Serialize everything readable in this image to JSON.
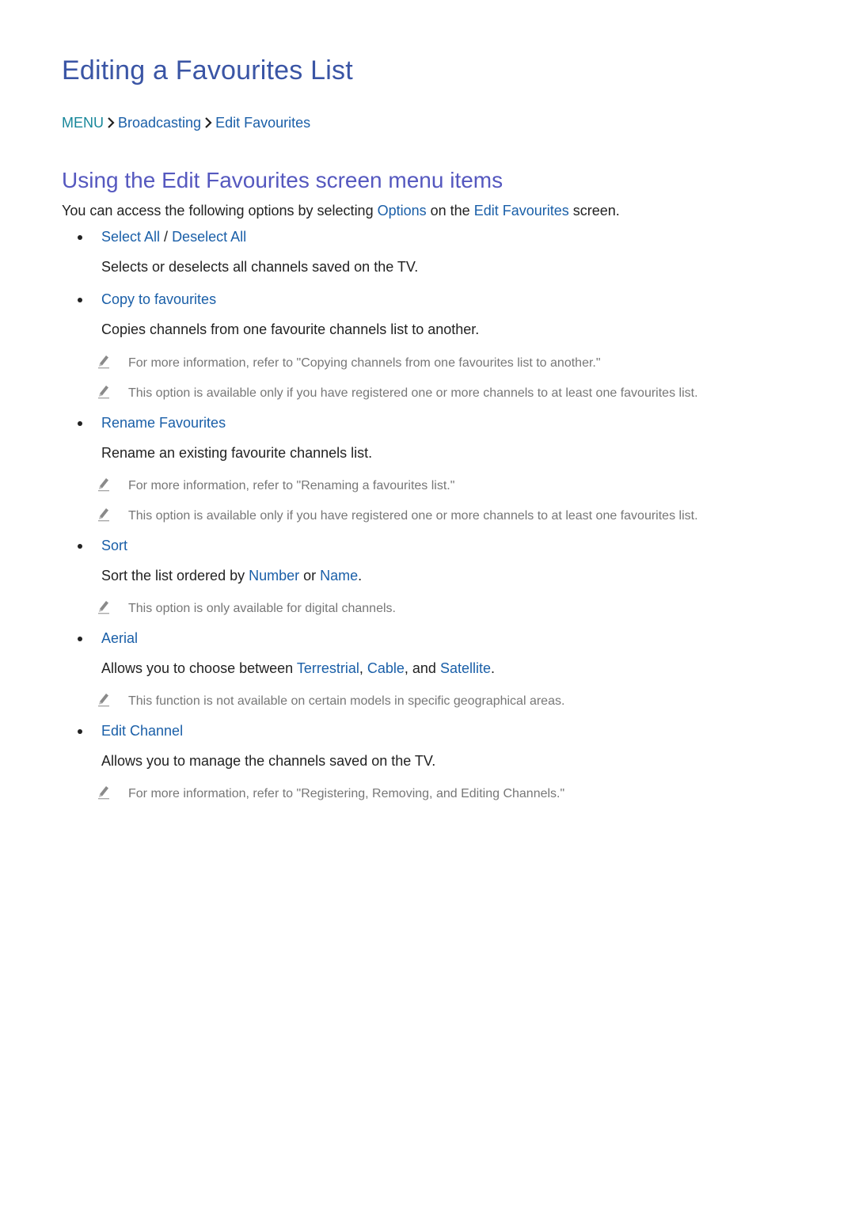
{
  "title": "Editing a Favourites List",
  "breadcrumb": {
    "items": [
      "MENU",
      "Broadcasting",
      "Edit Favourites"
    ],
    "separator_icon": "chevron-right-icon"
  },
  "subtitle": "Using the Edit Favourites screen menu items",
  "intro": {
    "before": "You can access the following options by selecting ",
    "link1": "Options",
    "middle": " on the ",
    "link2": "Edit Favourites",
    "after": " screen."
  },
  "items": [
    {
      "label": "Select All",
      "slash": " / ",
      "label2": "Deselect All",
      "desc": "Selects or deselects all channels saved on the TV.",
      "notes": []
    },
    {
      "label": "Copy to favourites",
      "desc": "Copies channels from one favourite channels list to another.",
      "notes": [
        "For more information, refer to \"Copying channels from one favourites list to another.\"",
        "This option is available only if you have registered one or more channels to at least one favourites list."
      ]
    },
    {
      "label": "Rename Favourites",
      "desc": "Rename an existing favourite channels list.",
      "notes": [
        "For more information, refer to \"Renaming a favourites list.\"",
        "This option is available only if you have registered one or more channels to at least one favourites list."
      ]
    },
    {
      "label": "Sort",
      "desc_before": "Sort the list ordered by ",
      "desc_link1": "Number",
      "desc_middle": " or ",
      "desc_link2": "Name",
      "desc_after": ".",
      "notes": [
        "This option is only available for digital channels."
      ]
    },
    {
      "label": "Aerial",
      "desc_before": "Allows you to choose between ",
      "desc_link1": "Terrestrial",
      "desc_sep1": ", ",
      "desc_link2": "Cable",
      "desc_sep2": ", and ",
      "desc_link3": "Satellite",
      "desc_after": ".",
      "notes": [
        "This function is not available on certain models in specific geographical areas."
      ]
    },
    {
      "label": "Edit Channel",
      "desc": "Allows you to manage the channels saved on the TV.",
      "notes": [
        "For more information, refer to \"Registering, Removing, and Editing Channels.\""
      ]
    }
  ],
  "note_icon": "pencil-icon",
  "colors": {
    "title": "#3a55a5",
    "subtitle": "#5558bf",
    "menu": "#17879a",
    "link": "#1a5fa8",
    "body": "#222222",
    "note": "#777777"
  }
}
